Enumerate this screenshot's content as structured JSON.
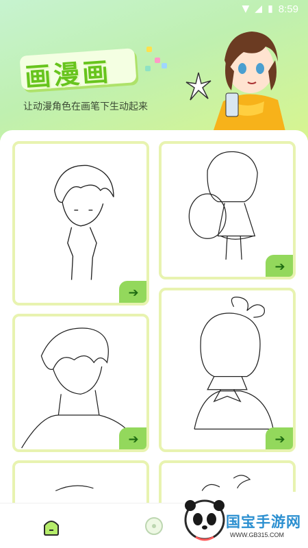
{
  "status": {
    "time": "8:59",
    "icons": [
      "wifi-icon",
      "signal-icon",
      "battery-icon"
    ]
  },
  "header": {
    "title": "画漫画",
    "subtitle": "让动漫角色在画笔下生动起来",
    "accent": "#67c41d"
  },
  "cards": [
    {
      "name": "boy-sketch",
      "action": "➔"
    },
    {
      "name": "girl-sketch",
      "action": "➔"
    },
    {
      "name": "teen-sketch",
      "action": "➔"
    },
    {
      "name": "schoolgirl-sketch",
      "action": "➔"
    },
    {
      "name": "partial-sketch-left",
      "action": ""
    },
    {
      "name": "partial-sketch-right",
      "action": ""
    }
  ],
  "tabs": [
    {
      "name": "home",
      "icon": "home-icon"
    },
    {
      "name": "discover",
      "icon": "circle-icon"
    },
    {
      "name": "profile",
      "icon": "user-icon"
    }
  ],
  "watermark": {
    "text": "国宝手游网",
    "url": "WWW.GB315.COM"
  }
}
